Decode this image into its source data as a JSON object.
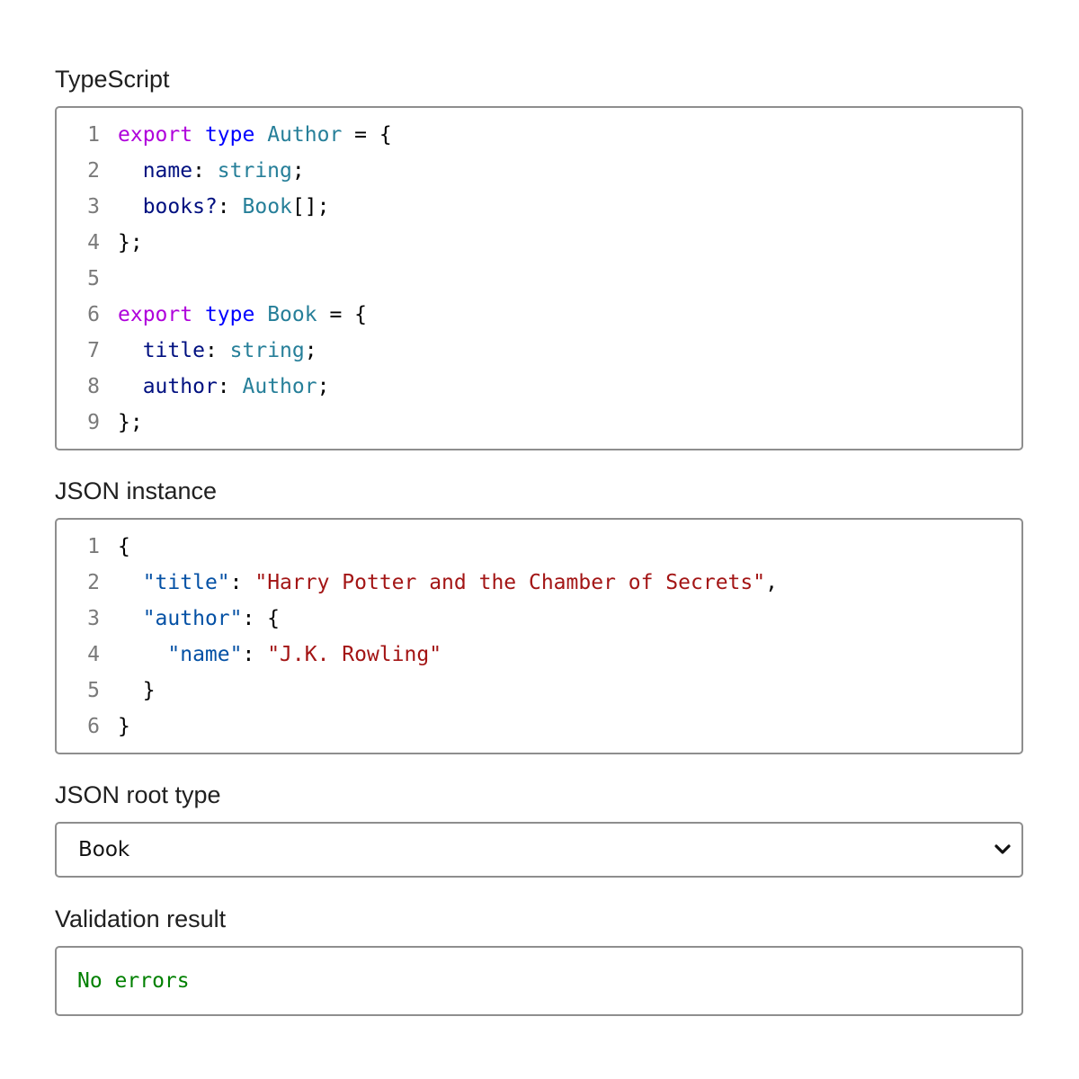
{
  "sections": {
    "typescript_label": "TypeScript",
    "json_label": "JSON instance",
    "root_type_label": "JSON root type",
    "validation_label": "Validation result"
  },
  "typescript_code": [
    [
      {
        "t": "export",
        "c": "keyword"
      },
      {
        "t": " ",
        "c": "ws"
      },
      {
        "t": "type",
        "c": "keyword2"
      },
      {
        "t": " ",
        "c": "ws"
      },
      {
        "t": "Author",
        "c": "type"
      },
      {
        "t": " = {",
        "c": "punct"
      }
    ],
    [
      {
        "t": "  ",
        "c": "ws"
      },
      {
        "t": "name",
        "c": "prop"
      },
      {
        "t": ": ",
        "c": "punct"
      },
      {
        "t": "string",
        "c": "type"
      },
      {
        "t": ";",
        "c": "punct"
      }
    ],
    [
      {
        "t": "  ",
        "c": "ws"
      },
      {
        "t": "books?",
        "c": "prop"
      },
      {
        "t": ": ",
        "c": "punct"
      },
      {
        "t": "Book",
        "c": "type"
      },
      {
        "t": "[];",
        "c": "punct"
      }
    ],
    [
      {
        "t": "};",
        "c": "punct"
      }
    ],
    [],
    [
      {
        "t": "export",
        "c": "keyword"
      },
      {
        "t": " ",
        "c": "ws"
      },
      {
        "t": "type",
        "c": "keyword2"
      },
      {
        "t": " ",
        "c": "ws"
      },
      {
        "t": "Book",
        "c": "type"
      },
      {
        "t": " = {",
        "c": "punct"
      }
    ],
    [
      {
        "t": "  ",
        "c": "ws"
      },
      {
        "t": "title",
        "c": "prop"
      },
      {
        "t": ": ",
        "c": "punct"
      },
      {
        "t": "string",
        "c": "type"
      },
      {
        "t": ";",
        "c": "punct"
      }
    ],
    [
      {
        "t": "  ",
        "c": "ws"
      },
      {
        "t": "author",
        "c": "prop"
      },
      {
        "t": ": ",
        "c": "punct"
      },
      {
        "t": "Author",
        "c": "type"
      },
      {
        "t": ";",
        "c": "punct"
      }
    ],
    [
      {
        "t": "};",
        "c": "punct"
      }
    ]
  ],
  "json_code": [
    [
      {
        "t": "{",
        "c": "punct"
      }
    ],
    [
      {
        "t": "  ",
        "c": "ws"
      },
      {
        "t": "\"title\"",
        "c": "key"
      },
      {
        "t": ": ",
        "c": "punct"
      },
      {
        "t": "\"Harry Potter and the Chamber of Secrets\"",
        "c": "string"
      },
      {
        "t": ",",
        "c": "punct"
      }
    ],
    [
      {
        "t": "  ",
        "c": "ws"
      },
      {
        "t": "\"author\"",
        "c": "key"
      },
      {
        "t": ": {",
        "c": "punct"
      }
    ],
    [
      {
        "t": "    ",
        "c": "ws"
      },
      {
        "t": "\"name\"",
        "c": "key"
      },
      {
        "t": ": ",
        "c": "punct"
      },
      {
        "t": "\"J.K. Rowling\"",
        "c": "string"
      }
    ],
    [
      {
        "t": "  }",
        "c": "punct"
      }
    ],
    [
      {
        "t": "}",
        "c": "punct"
      }
    ]
  ],
  "root_type": {
    "selected": "Book",
    "icon": "chevron-down-icon"
  },
  "validation": {
    "result": "No errors",
    "color": "#008000"
  },
  "colors": {
    "keyword": "#af00db",
    "keyword2": "#0000ff",
    "type": "#267f99",
    "property": "#001080",
    "json_key": "#0451a5",
    "string": "#a31515",
    "line_number": "#7a7a7a",
    "border": "#8e8e8e"
  }
}
